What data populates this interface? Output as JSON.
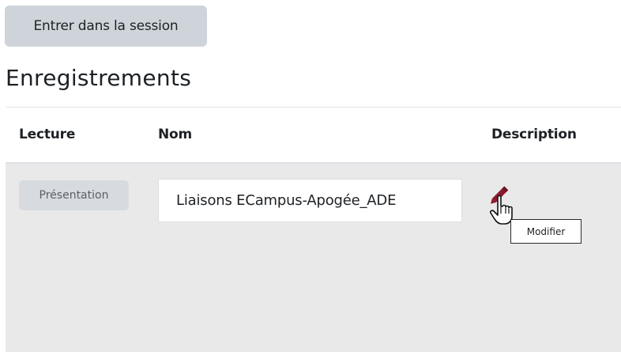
{
  "actions": {
    "enter_session_label": "Entrer dans la session"
  },
  "recordings": {
    "title": "Enregistrements",
    "columns": {
      "playback": "Lecture",
      "name": "Nom",
      "description": "Description"
    },
    "rows": [
      {
        "playback_label": "Présentation",
        "name_value": "Liaisons ECampus-Apogée_ADE",
        "edit_tooltip": "Modifier"
      }
    ]
  },
  "icons": {
    "edit": "pencil-icon",
    "cursor": "hand-pointer-icon"
  },
  "colors": {
    "button_bg": "#ced4da",
    "row_bg": "#e9e9e9",
    "pencil": "#8b1a2e"
  }
}
